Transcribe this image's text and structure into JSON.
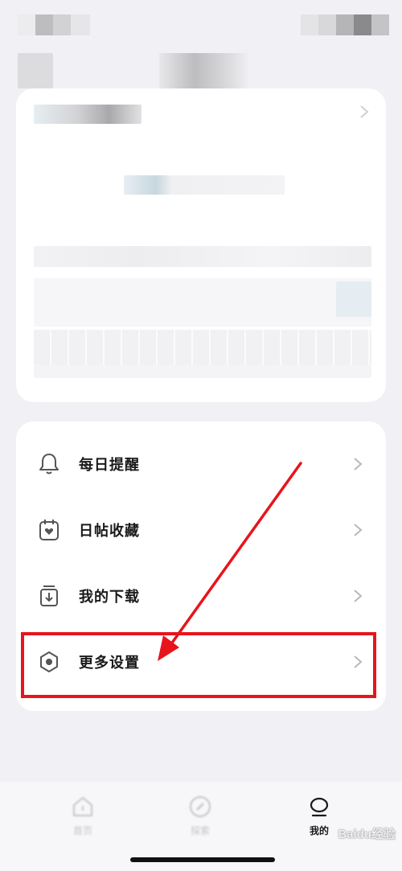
{
  "menu": {
    "items": [
      {
        "label": "每日提醒"
      },
      {
        "label": "日帖收藏"
      },
      {
        "label": "我的下载"
      },
      {
        "label": "更多设置"
      }
    ]
  },
  "tabbar": {
    "tabs": [
      {
        "label": "首页"
      },
      {
        "label": "探索"
      },
      {
        "label": "我的"
      }
    ]
  },
  "watermark": "Baidu经验"
}
